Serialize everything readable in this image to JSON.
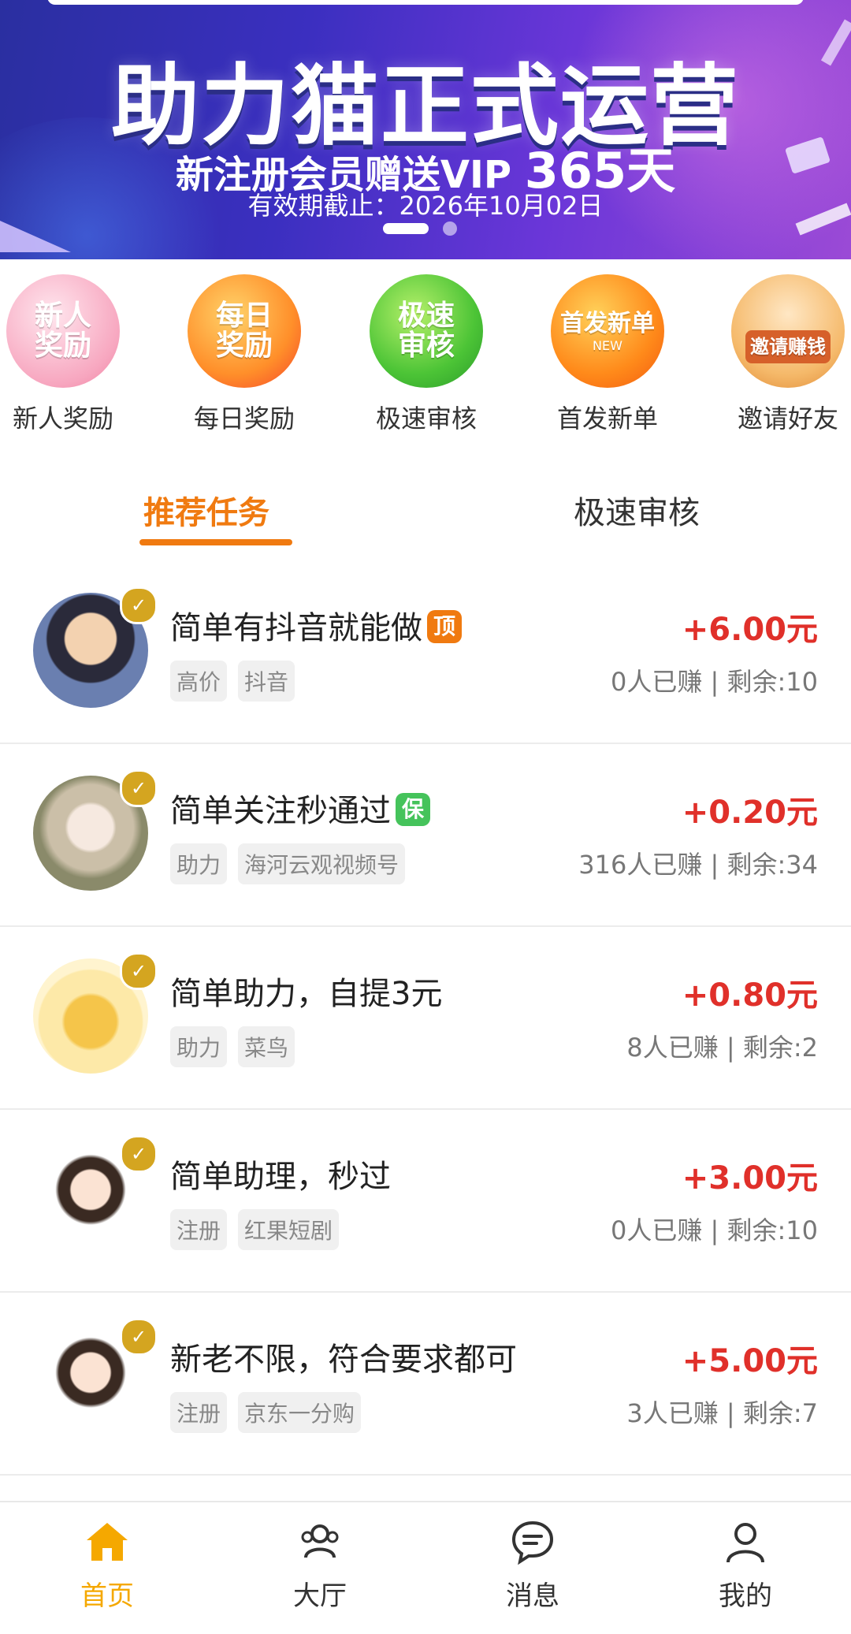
{
  "banner": {
    "title": "助力猫正式运营",
    "subtitle_prefix": "新注册会员赠送VIP",
    "subtitle_days": "365天",
    "expiry": "有效期截止：2026年10月02日"
  },
  "quick_links": [
    {
      "icon_text": "新人奖励",
      "label": "新人奖励"
    },
    {
      "icon_text": "每日奖励",
      "label": "每日奖励"
    },
    {
      "icon_text": "极速审核",
      "label": "极速审核"
    },
    {
      "icon_text": "首发新单",
      "icon_small": "NEW",
      "label": "首发新单"
    },
    {
      "icon_text": "邀请赚钱",
      "label": "邀请好友"
    }
  ],
  "tabs": [
    {
      "label": "推荐任务",
      "active": true
    },
    {
      "label": "极速审核",
      "active": false
    }
  ],
  "tasks": [
    {
      "title": "简单有抖音就能做",
      "flag": "顶",
      "tags": [
        "高价",
        "抖音"
      ],
      "reward": "+6.00元",
      "stats": "0人已赚 | 剩余:10"
    },
    {
      "title": "简单关注秒通过",
      "flag": "保",
      "tags": [
        "助力",
        "海河云观视频号"
      ],
      "reward": "+0.20元",
      "stats": "316人已赚 | 剩余:34"
    },
    {
      "title": "简单助力，自提3元",
      "flag": "",
      "tags": [
        "助力",
        "菜鸟"
      ],
      "reward": "+0.80元",
      "stats": "8人已赚 | 剩余:2"
    },
    {
      "title": "简单助理，秒过",
      "flag": "",
      "tags": [
        "注册",
        "红果短剧"
      ],
      "reward": "+3.00元",
      "stats": "0人已赚 | 剩余:10"
    },
    {
      "title": "新老不限，符合要求都可",
      "flag": "",
      "tags": [
        "注册",
        "京东一分购"
      ],
      "reward": "+5.00元",
      "stats": "3人已赚 | 剩余:7"
    }
  ],
  "bottom_nav": [
    {
      "label": "首页",
      "icon": "home-icon",
      "active": true
    },
    {
      "label": "大厅",
      "icon": "people-icon",
      "active": false
    },
    {
      "label": "消息",
      "icon": "chat-icon",
      "active": false
    },
    {
      "label": "我的",
      "icon": "user-icon",
      "active": false
    }
  ],
  "colors": {
    "accent": "#f07a10",
    "reward": "#e0302a",
    "nav_active": "#f5a800"
  }
}
